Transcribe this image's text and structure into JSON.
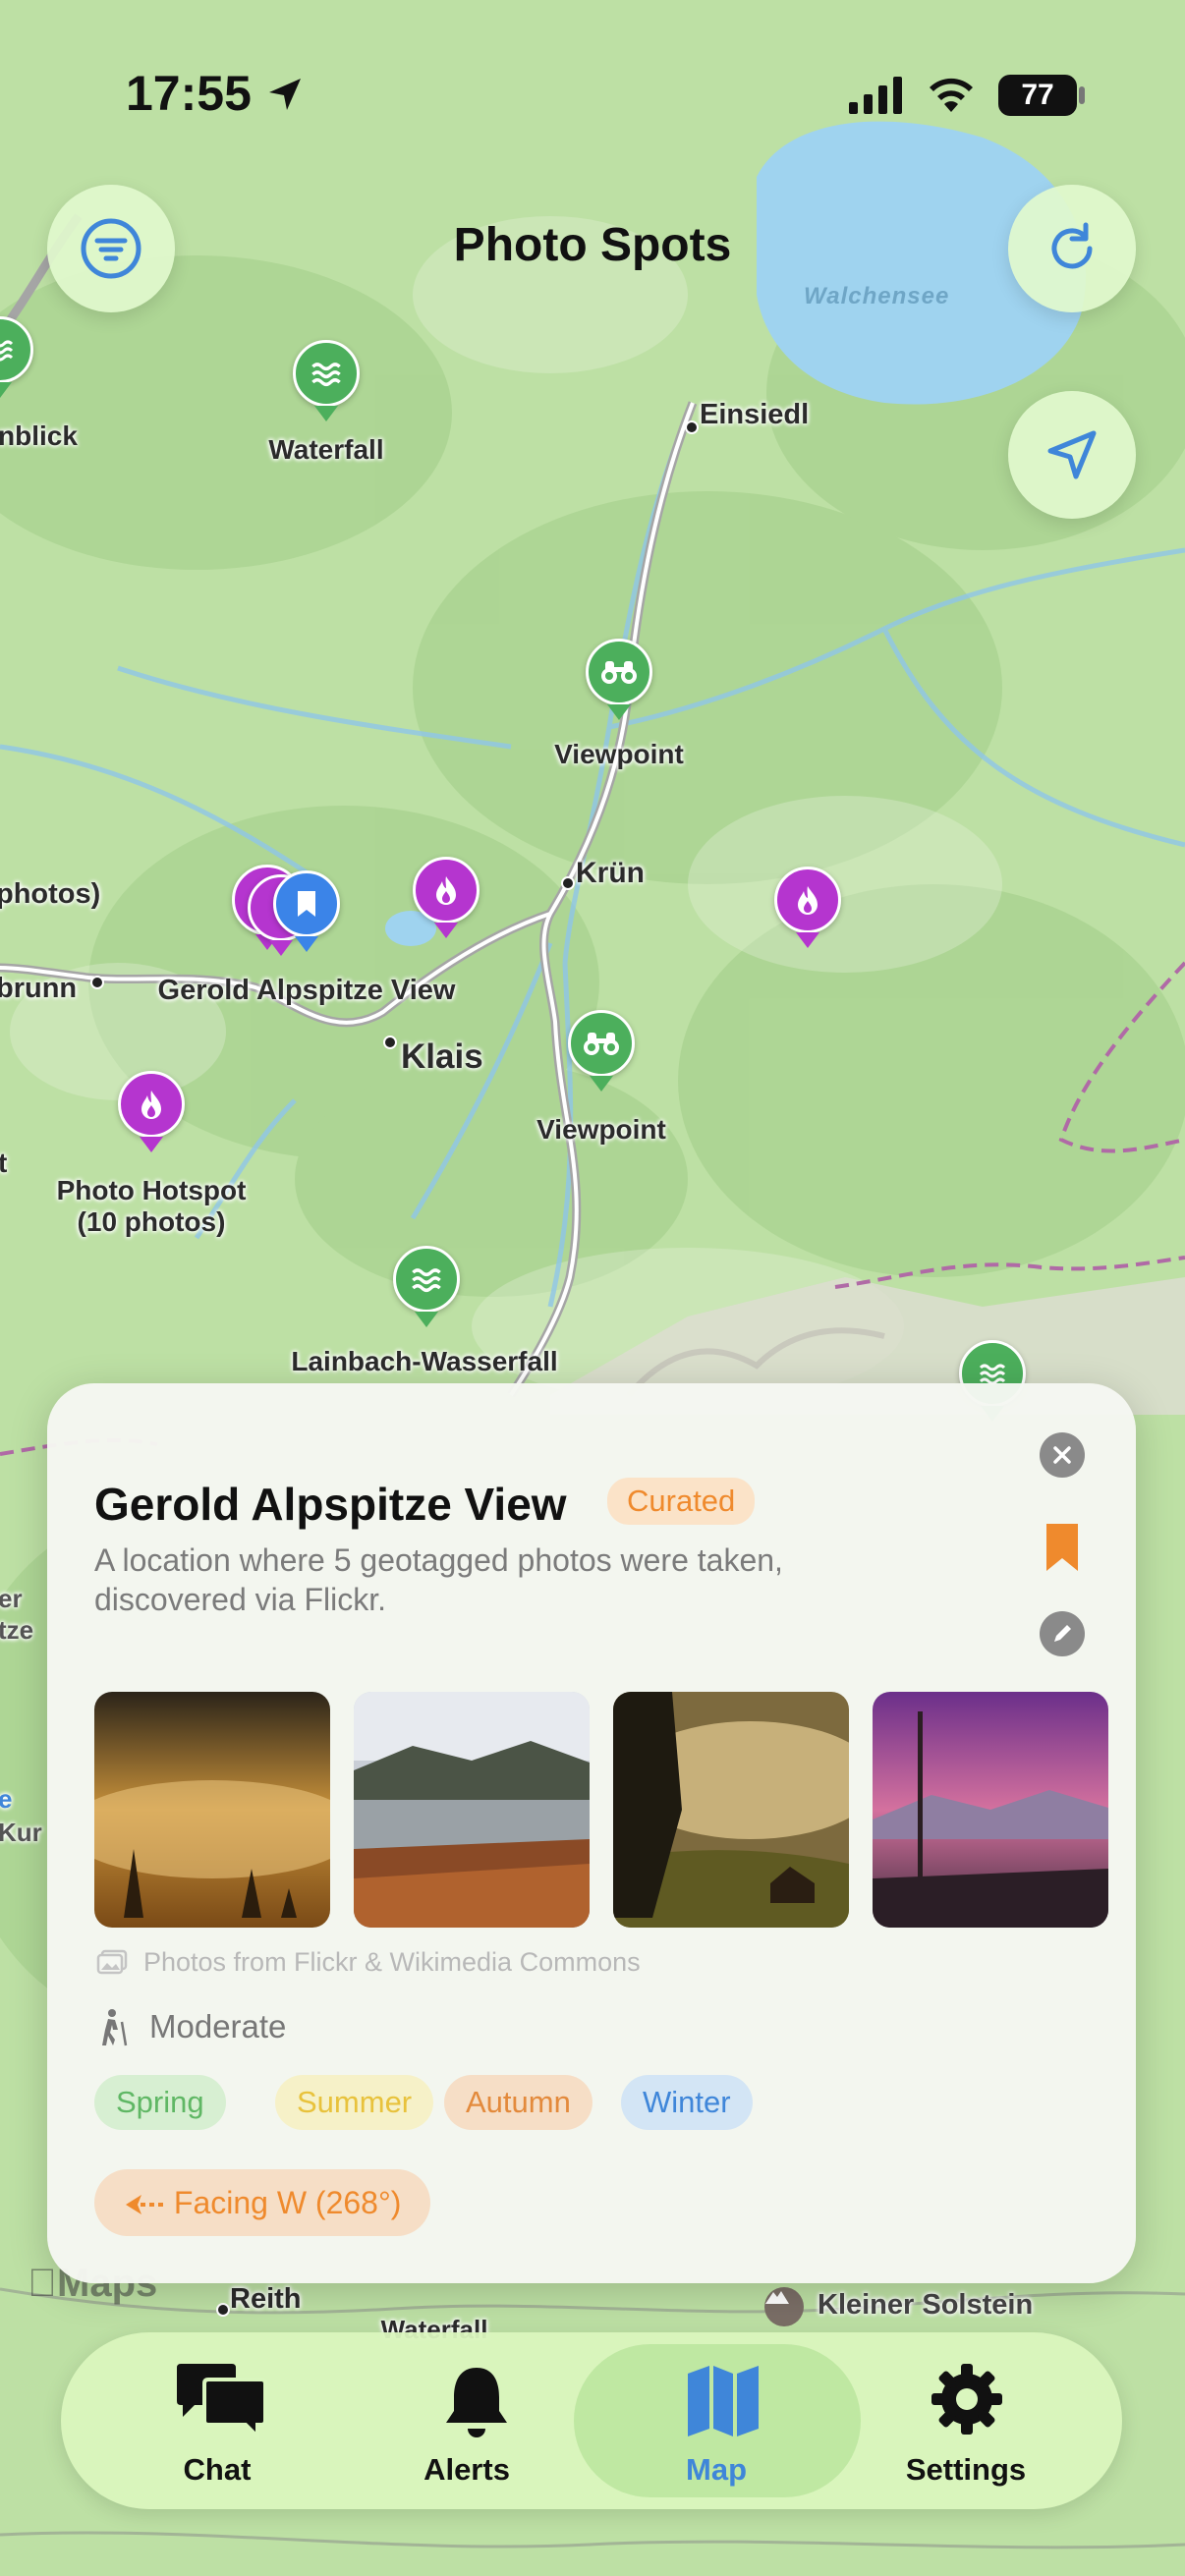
{
  "status_bar": {
    "time": "17:55",
    "battery": "77"
  },
  "header": {
    "title": "Photo Spots"
  },
  "map": {
    "lake_label": "Walchensee",
    "labels": {
      "einsiedl": "Einsiedl",
      "waterfall_top": "Waterfall",
      "blick_partial": "nblick",
      "viewpoint_top": "Viewpoint",
      "kruen": "Krün",
      "photos_partial": "photos)",
      "brunn_partial": "brunn",
      "gerold": "Gerold Alpspitze View",
      "klais": "Klais",
      "viewpoint_mid": "Viewpoint",
      "t_partial": "t",
      "hotspot_line1": "Photo Hotspot",
      "hotspot_line2": "(10 photos)",
      "lainbach": "Lainbach-Wasserfall",
      "er_partial": "er",
      "tze_partial": "tze",
      "e_partial": "e",
      "kur_partial": "Kur",
      "reith": "Reith",
      "waterfall_bottom": "Waterfall",
      "kleiner_solstein": "Kleiner Solstein",
      "apple_maps": "Maps"
    }
  },
  "card": {
    "title": "Gerold Alpspitze View",
    "badge": "Curated",
    "description": "A location where 5 geotagged photos were taken, discovered via Flickr.",
    "photo_credit": "Photos from Flickr & Wikimedia Commons",
    "difficulty": "Moderate",
    "seasons": [
      "Spring",
      "Summer",
      "Autumn",
      "Winter"
    ],
    "facing": "Facing W (268°)"
  },
  "tabs": [
    {
      "label": "Chat"
    },
    {
      "label": "Alerts"
    },
    {
      "label": "Map"
    },
    {
      "label": "Settings"
    }
  ],
  "colors": {
    "accent_blue": "#3f86d9",
    "curated_orange": "#ef8a2d",
    "pin_purple": "#b535cf",
    "pin_green": "#4caf5c",
    "season_spring": "#5fb764",
    "season_summer": "#e8c23c",
    "season_autumn": "#e38a3c",
    "season_winter": "#3f86d9"
  }
}
